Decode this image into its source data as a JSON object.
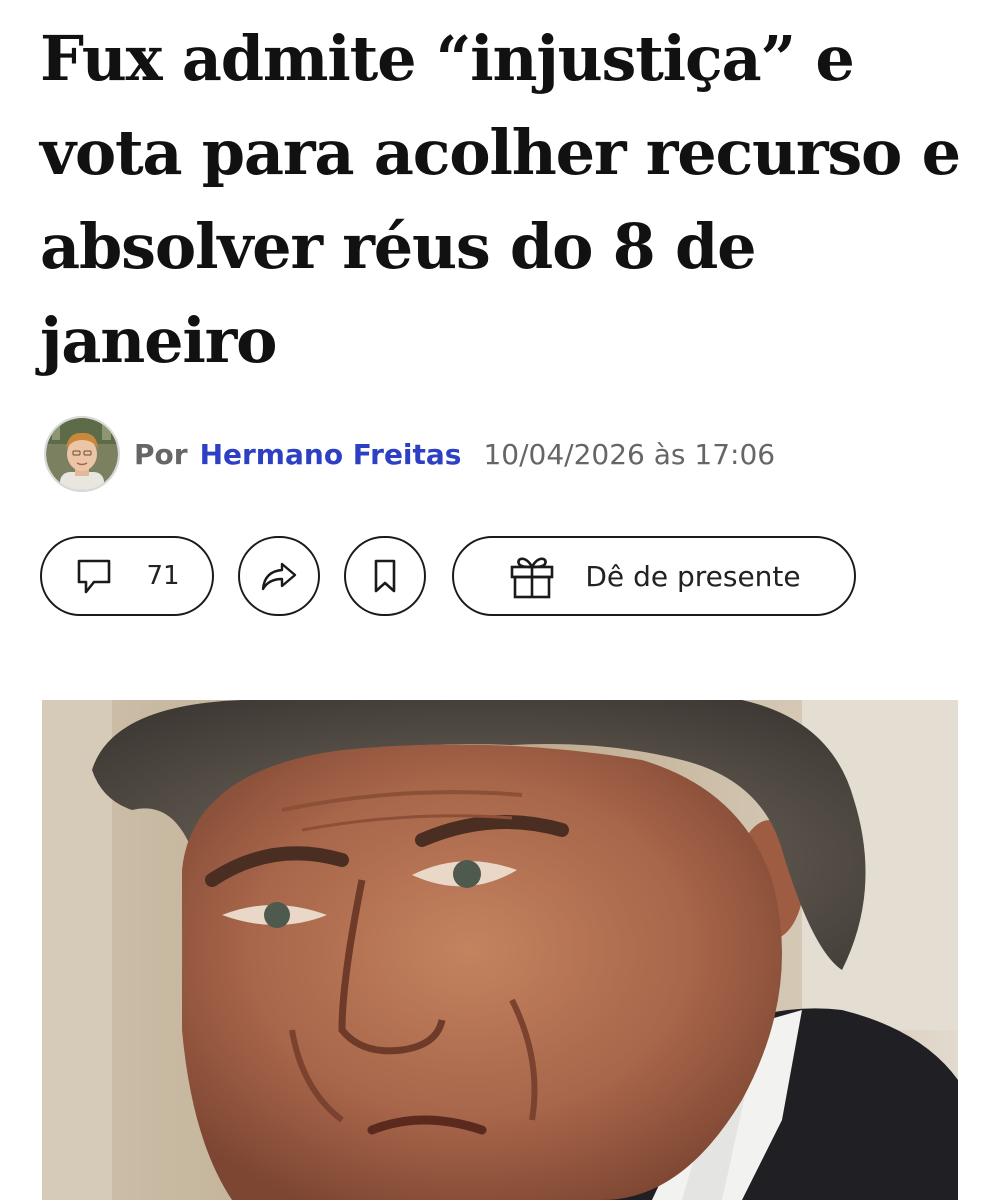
{
  "article": {
    "headline": "Fux admite “injustiça” e vota para acolher recurso e absolver réus do 8 de janeiro",
    "byline_prefix": "Por",
    "author": "Hermano Freitas",
    "date": "10/04/2026 às 17:06"
  },
  "actions": {
    "comment_count": "71",
    "gift_label": "Dê de presente"
  },
  "icons": {
    "comment": "comment-bubble-icon",
    "share": "share-arrow-icon",
    "bookmark": "bookmark-icon",
    "gift": "gift-icon"
  },
  "colors": {
    "author_link": "#2d3fc2",
    "meta_text": "#666666",
    "headline": "#111111"
  }
}
